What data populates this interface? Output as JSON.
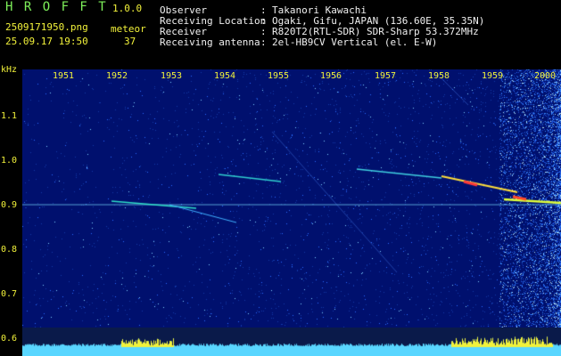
{
  "header": {
    "logo": "H R O F F T",
    "version": "1.0.0",
    "filename": "2509171950.png",
    "datetime": "25.09.17 19:50",
    "meteor_label": "meteor",
    "meteor_count": "37"
  },
  "station": {
    "rows": [
      {
        "label": "Observer",
        "value": "Takanori Kawachi"
      },
      {
        "label": "Receiving Location",
        "value": "Ogaki, Gifu, JAPAN (136.60E, 35.35N)"
      },
      {
        "label": "Receiver",
        "value": "R820T2(RTL-SDR) SDR-Sharp 53.372MHz"
      },
      {
        "label": "Receiving antenna",
        "value": "2el-HB9CV Vertical (el. E-W)"
      }
    ],
    "separator": ": "
  },
  "axes": {
    "y_unit": "kHz",
    "y_ticks": [
      "1.1",
      "1.0",
      "0.9",
      "0.8",
      "0.7",
      "0.6"
    ],
    "x_ticks": [
      "1951",
      "1952",
      "1953",
      "1954",
      "1955",
      "1956",
      "1957",
      "1958",
      "1959",
      "2000"
    ]
  },
  "colors": {
    "background": "#000000",
    "spectrogram_bg": "#00106e",
    "header_green": "#7ef05a",
    "tick_yellow": "#f2f23a",
    "header_white": "#f0f0f0",
    "level_cyan": "#59d6ff",
    "level_yellow": "#f2f23a"
  }
}
